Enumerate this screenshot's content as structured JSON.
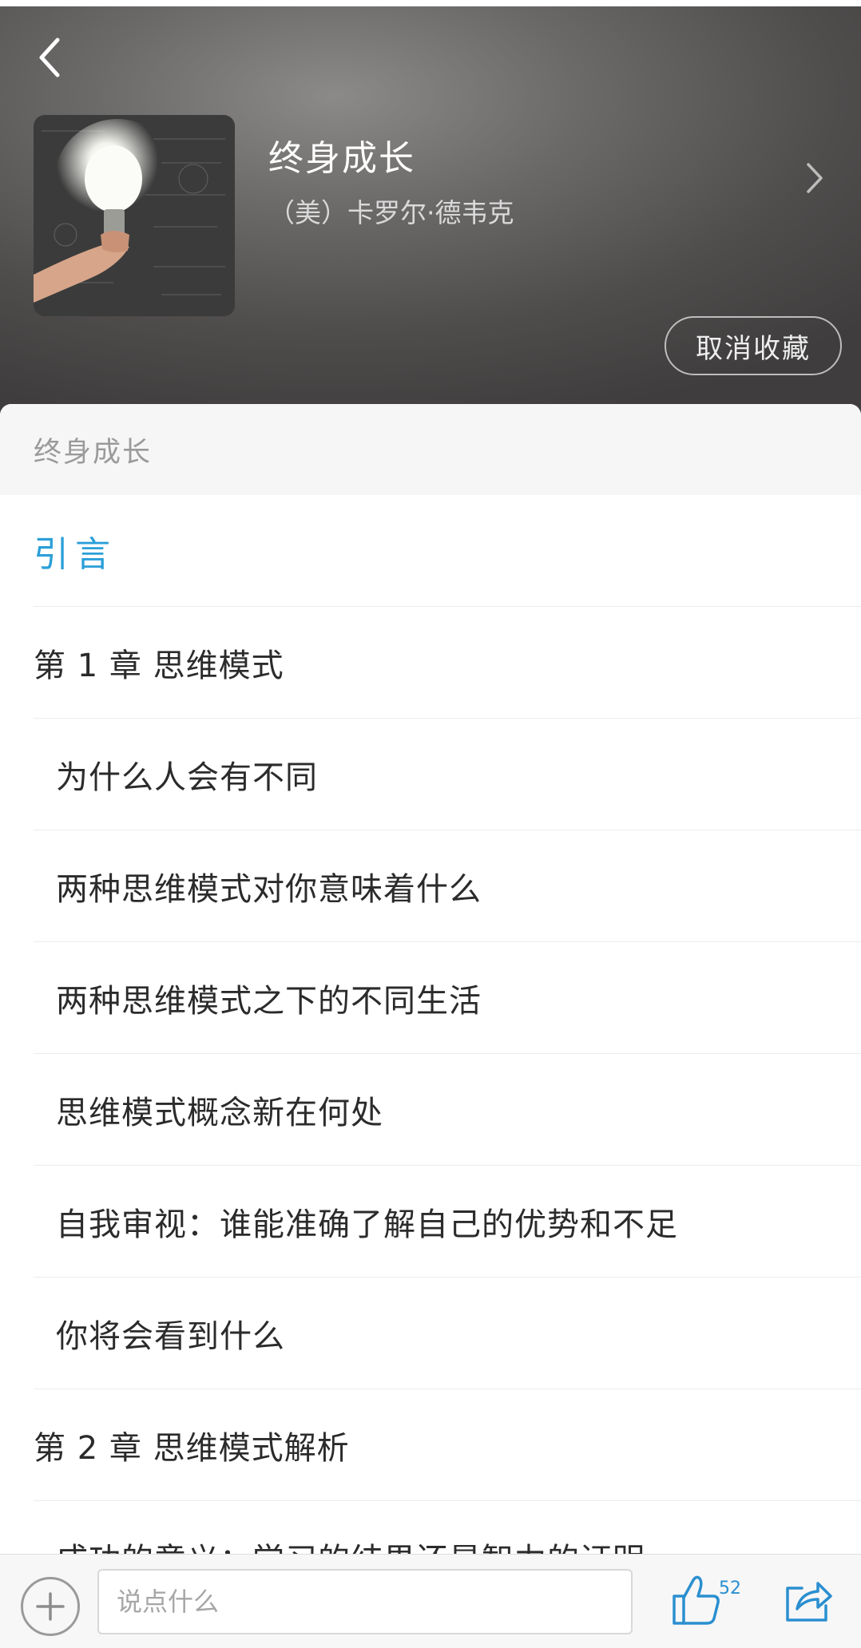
{
  "book": {
    "title": "终身成长",
    "author": "（美）卡罗尔·德韦克",
    "unfavorite_label": "取消收藏"
  },
  "toc": {
    "header": "终身成长",
    "items": [
      {
        "label": "引言",
        "level": "chapter",
        "active": true
      },
      {
        "label": "第 1 章 思维模式",
        "level": "chapter",
        "active": false
      },
      {
        "label": "为什么人会有不同",
        "level": "section",
        "active": false
      },
      {
        "label": "两种思维模式对你意味着什么",
        "level": "section",
        "active": false
      },
      {
        "label": "两种思维模式之下的不同生活",
        "level": "section",
        "active": false
      },
      {
        "label": "思维模式概念新在何处",
        "level": "section",
        "active": false
      },
      {
        "label": "自我审视：谁能准确了解自己的优势和不足",
        "level": "section",
        "active": false
      },
      {
        "label": "你将会看到什么",
        "level": "section",
        "active": false
      },
      {
        "label": "第 2 章 思维模式解析",
        "level": "chapter",
        "active": false
      },
      {
        "label": "成功的意义：学习的结果还是智力的证明",
        "level": "section",
        "active": false
      }
    ]
  },
  "bottom_bar": {
    "comment_placeholder": "说点什么",
    "like_count": "52"
  },
  "colors": {
    "accent": "#2a9fd8",
    "icon_blue": "#2a8fd0",
    "text": "#2b2b2b",
    "muted": "#9a9a9a"
  },
  "icons": [
    "back-arrow-icon",
    "book-cover-image",
    "chevron-right-icon",
    "plus-icon",
    "thumbs-up-icon",
    "share-icon"
  ]
}
